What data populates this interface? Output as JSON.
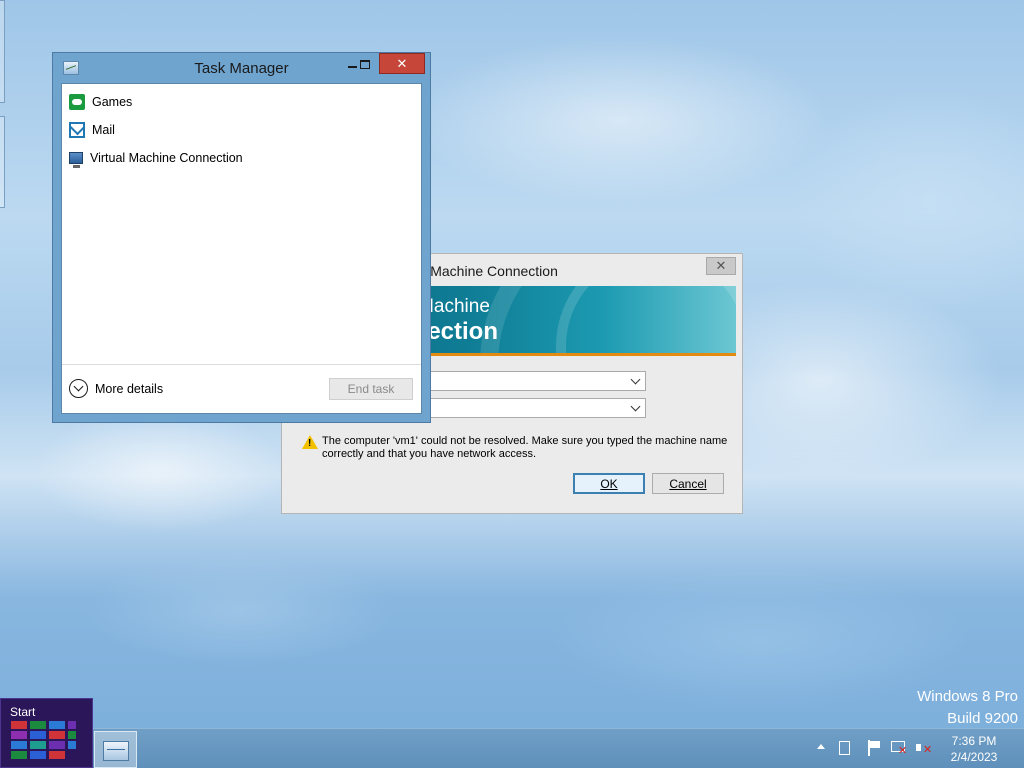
{
  "task_manager": {
    "title": "Task Manager",
    "items": [
      {
        "label": "Games",
        "icon": "games-icon"
      },
      {
        "label": "Mail",
        "icon": "mail-icon"
      },
      {
        "label": "Virtual Machine Connection",
        "icon": "virtual-machine-icon"
      }
    ],
    "more_details_label": "More details",
    "end_task_label": "End task"
  },
  "vmc_dialog": {
    "title": "Virtual Machine Connection",
    "visible_title_fragment": "irtual Machine Connection",
    "banner_line1": "al Machine",
    "banner_line2": "nnection",
    "warning_text": "The computer 'vm1' could not be resolved. Make sure you typed the machine name correctly and that you have network access.",
    "ok_label": "OK",
    "cancel_label": "Cancel"
  },
  "watermark": {
    "line1": "Windows 8 Pro",
    "line2": "Build 9200"
  },
  "taskbar": {
    "start_label": "Start",
    "time": "7:36 PM",
    "date": "2/4/2023"
  },
  "colors": {
    "accent": "#1f78b4",
    "close_red": "#c7463a",
    "banner_teal": "#0f7d95",
    "banner_orange": "#e38a13",
    "start_tile": "#2a1658"
  }
}
